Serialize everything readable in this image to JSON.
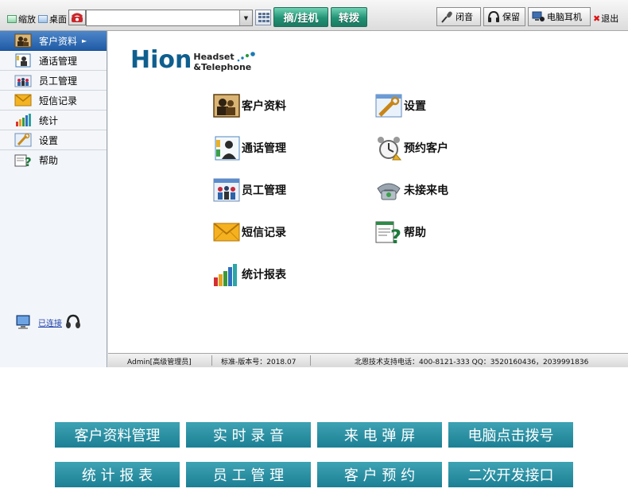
{
  "toolbar": {
    "minimize_label": "缩放",
    "desktop_label": "桌面",
    "number_value": "",
    "hangup_label": "摘/挂机",
    "transfer_label": "转拨",
    "mute_label": "闭音",
    "hold_label": "保留",
    "pc_headset_label": "电脑耳机",
    "exit_label": "退出"
  },
  "sidebar": {
    "items": [
      {
        "label": "客户资料",
        "icon": "customer-info-icon",
        "active": true
      },
      {
        "label": "通话管理",
        "icon": "call-management-icon"
      },
      {
        "label": "员工管理",
        "icon": "staff-management-icon"
      },
      {
        "label": "短信记录",
        "icon": "sms-envelope-icon"
      },
      {
        "label": "统计",
        "icon": "statistics-chart-icon"
      },
      {
        "label": "设置",
        "icon": "settings-icon"
      },
      {
        "label": "帮助",
        "icon": "help-icon"
      }
    ],
    "connection_label": "已连接"
  },
  "brand": {
    "word": "Hion",
    "sub_line1": "Headset",
    "sub_line2": "&Telephone"
  },
  "tiles": [
    {
      "label": "客户资料",
      "icon": "customer-info-icon"
    },
    {
      "label": "设置",
      "icon": "settings-icon"
    },
    {
      "label": "通话管理",
      "icon": "call-management-icon"
    },
    {
      "label": "预约客户",
      "icon": "alarm-clock-icon"
    },
    {
      "label": "员工管理",
      "icon": "staff-management-icon"
    },
    {
      "label": "未接来电",
      "icon": "missed-call-phone-icon"
    },
    {
      "label": "短信记录",
      "icon": "sms-envelope-icon"
    },
    {
      "label": "帮助",
      "icon": "help-icon"
    },
    {
      "label": "统计报表",
      "icon": "statistics-chart-icon"
    }
  ],
  "statusbar": {
    "user": "Admin[高级管理员]",
    "version": "标准-版本号：2018.07",
    "support": "北恩技术支持电话：400-8121-333  QQ：3520160436，2039991836"
  },
  "features": [
    "客户资料管理",
    "实 时 录 音",
    "来 电 弹 屏",
    "电脑点击拨号",
    "统 计 报 表",
    "员 工 管 理",
    "客 户 预 约",
    "二次开发接口"
  ],
  "colors": {
    "teal_button": "#229275",
    "sidebar_active": "#1f5ba5",
    "brand_blue": "#0f5f8e",
    "feature_teal": "#2a91a3"
  }
}
